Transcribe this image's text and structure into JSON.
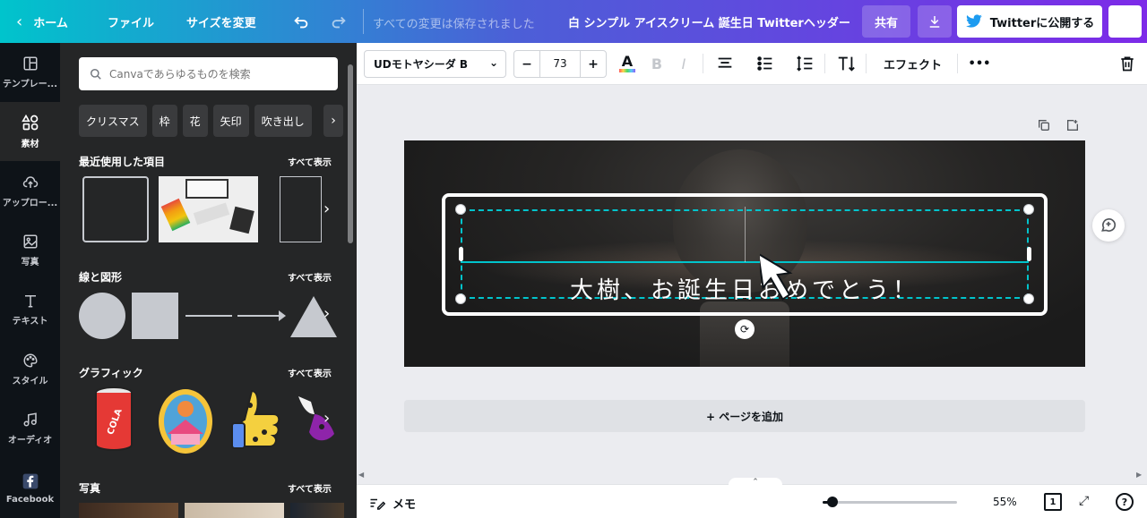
{
  "topbar": {
    "home_label": "ホーム",
    "file_label": "ファイル",
    "resize_label": "サイズを変更",
    "saved_status": "すべての変更は保存されました",
    "doc_title": "白 シンプル アイスクリーム 誕生日 Twitterヘッダー",
    "share_label": "共有",
    "publish_label": "Twitterに公開する"
  },
  "rail": {
    "items": [
      {
        "label": "テンプレー...",
        "icon": "template-icon"
      },
      {
        "label": "素材",
        "icon": "elements-icon"
      },
      {
        "label": "アップロー...",
        "icon": "upload-icon"
      },
      {
        "label": "写真",
        "icon": "photo-icon"
      },
      {
        "label": "テキスト",
        "icon": "text-icon"
      },
      {
        "label": "スタイル",
        "icon": "style-icon"
      },
      {
        "label": "オーディオ",
        "icon": "audio-icon"
      },
      {
        "label": "Facebook",
        "icon": "facebook-icon"
      }
    ]
  },
  "panel": {
    "search_placeholder": "Canvaであらゆるものを検索",
    "chips": [
      "クリスマス",
      "枠",
      "花",
      "矢印",
      "吹き出し"
    ],
    "see_all": "すべて表示",
    "sections": {
      "recent": "最近使用した項目",
      "lines_shapes": "線と図形",
      "graphics": "グラフィック",
      "photos": "写真"
    }
  },
  "toolbar": {
    "font_name": "UDモトヤシーダ B",
    "font_size": "73",
    "effects_label": "エフェクト"
  },
  "canvas": {
    "banner_text": "大樹、お誕生日おめでとう！",
    "add_page_label": "+ ページを追加"
  },
  "bottombar": {
    "memo_label": "メモ",
    "zoom_value": "55%",
    "page_count": "1",
    "help_label": "?"
  },
  "colors": {
    "accent": "#00c4cc",
    "brand_purple": "#7d2ae8",
    "dark_panel": "#252627",
    "rail": "#0e1318",
    "twitter_blue": "#1d9bf0"
  }
}
